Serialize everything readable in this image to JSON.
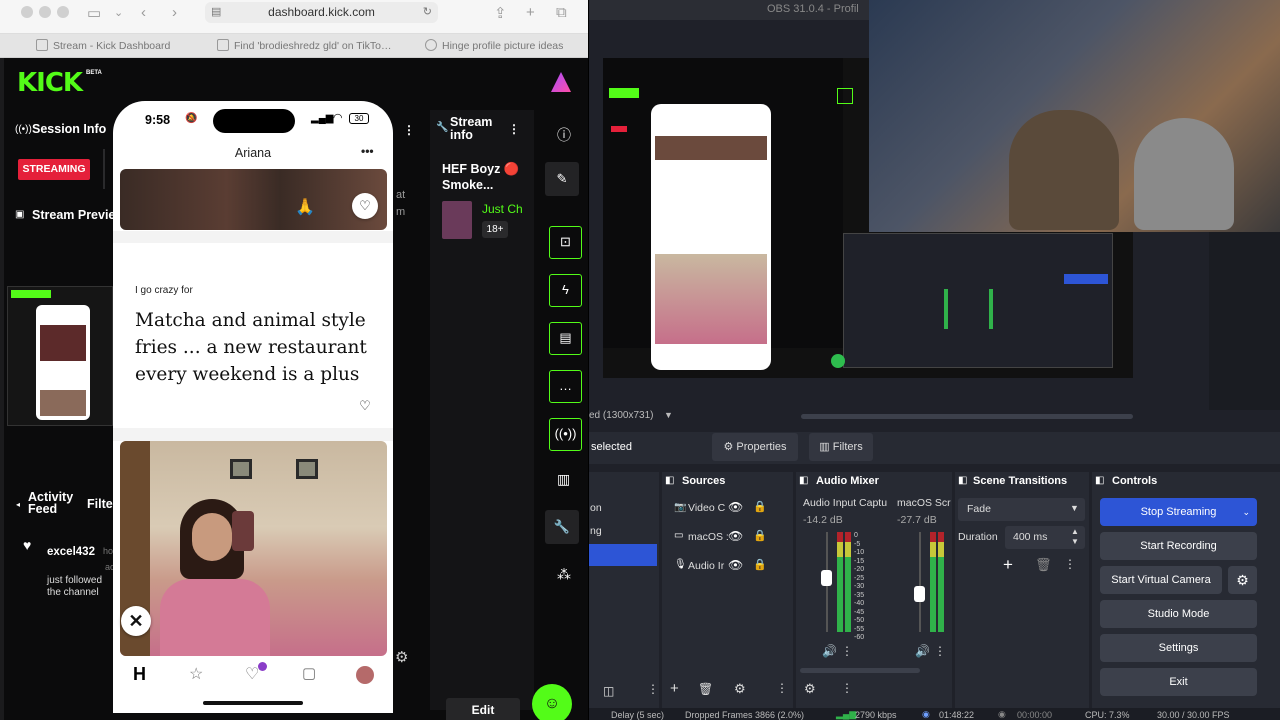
{
  "safari": {
    "url": "dashboard.kick.com",
    "tabs": [
      "Stream - Kick Dashboard",
      "Find 'brodieshredz gld' on TikTo…",
      "Hinge profile picture ideas"
    ]
  },
  "kick": {
    "logo": "KICK",
    "beta": "BETA",
    "session_info": "Session Info",
    "streaming": "STREAMING",
    "stream_preview": "Stream Previe",
    "stream_info": "Stream info",
    "stream_title": "HEF Boyz 🔴 Smoke...",
    "category": "Just Ch",
    "rating": "18+",
    "at": "at",
    "m": "m",
    "activity_feed": "Activity Feed",
    "filter": "Filte",
    "activity_user": "excel432",
    "activity_user_suffix": "ho",
    "activity_text": "just followed the channel",
    "activity_side": "ac",
    "edit": "Edit"
  },
  "phone": {
    "time": "9:58",
    "signal": "30",
    "profile_name": "Ariana",
    "more": "•••",
    "emoji": "🙏",
    "prompt_label": "I go crazy for",
    "prompt_answer": "Matcha and animal style fries ... a new restaurant every weekend is a plus"
  },
  "obs": {
    "title": "OBS 31.0.4 - Profil",
    "scaled": "ed (1300x731)",
    "selected": "selected",
    "properties": "Properties",
    "filters": "Filters",
    "scenes_items": [
      "on",
      "ng"
    ],
    "sources": {
      "header": "Sources",
      "items": [
        "Video C",
        "macOS :",
        "Audio Ir"
      ]
    },
    "mixer": {
      "header": "Audio Mixer",
      "ch1_name": "Audio Input Captu",
      "ch1_db": "-14.2 dB",
      "ch2_name": "macOS Scre",
      "ch2_db": "-27.7 dB",
      "scale": [
        "0",
        "-5",
        "-10",
        "-15",
        "-20",
        "-25",
        "-30",
        "-35",
        "-40",
        "-45",
        "-50",
        "-55",
        "-60"
      ]
    },
    "transitions": {
      "header": "Scene Transitions",
      "type": "Fade",
      "duration_label": "Duration",
      "duration_value": "400 ms"
    },
    "controls": {
      "header": "Controls",
      "stop_streaming": "Stop Streaming",
      "start_recording": "Start Recording",
      "start_virtual_camera": "Start Virtual Camera",
      "studio_mode": "Studio Mode",
      "settings": "Settings",
      "exit": "Exit"
    },
    "status": {
      "delay": "Delay (5 sec)",
      "dropped": "Dropped Frames 3866 (2.0%)",
      "kbps": "2790 kbps",
      "live_time": "01:48:22",
      "rec_time": "00:00:00",
      "cpu": "CPU: 7.3%",
      "fps": "30.00 / 30.00 FPS"
    }
  },
  "colors": {
    "kick_green": "#53fc18",
    "streaming_red": "#e5203a",
    "obs_blue": "#2d55d6"
  }
}
